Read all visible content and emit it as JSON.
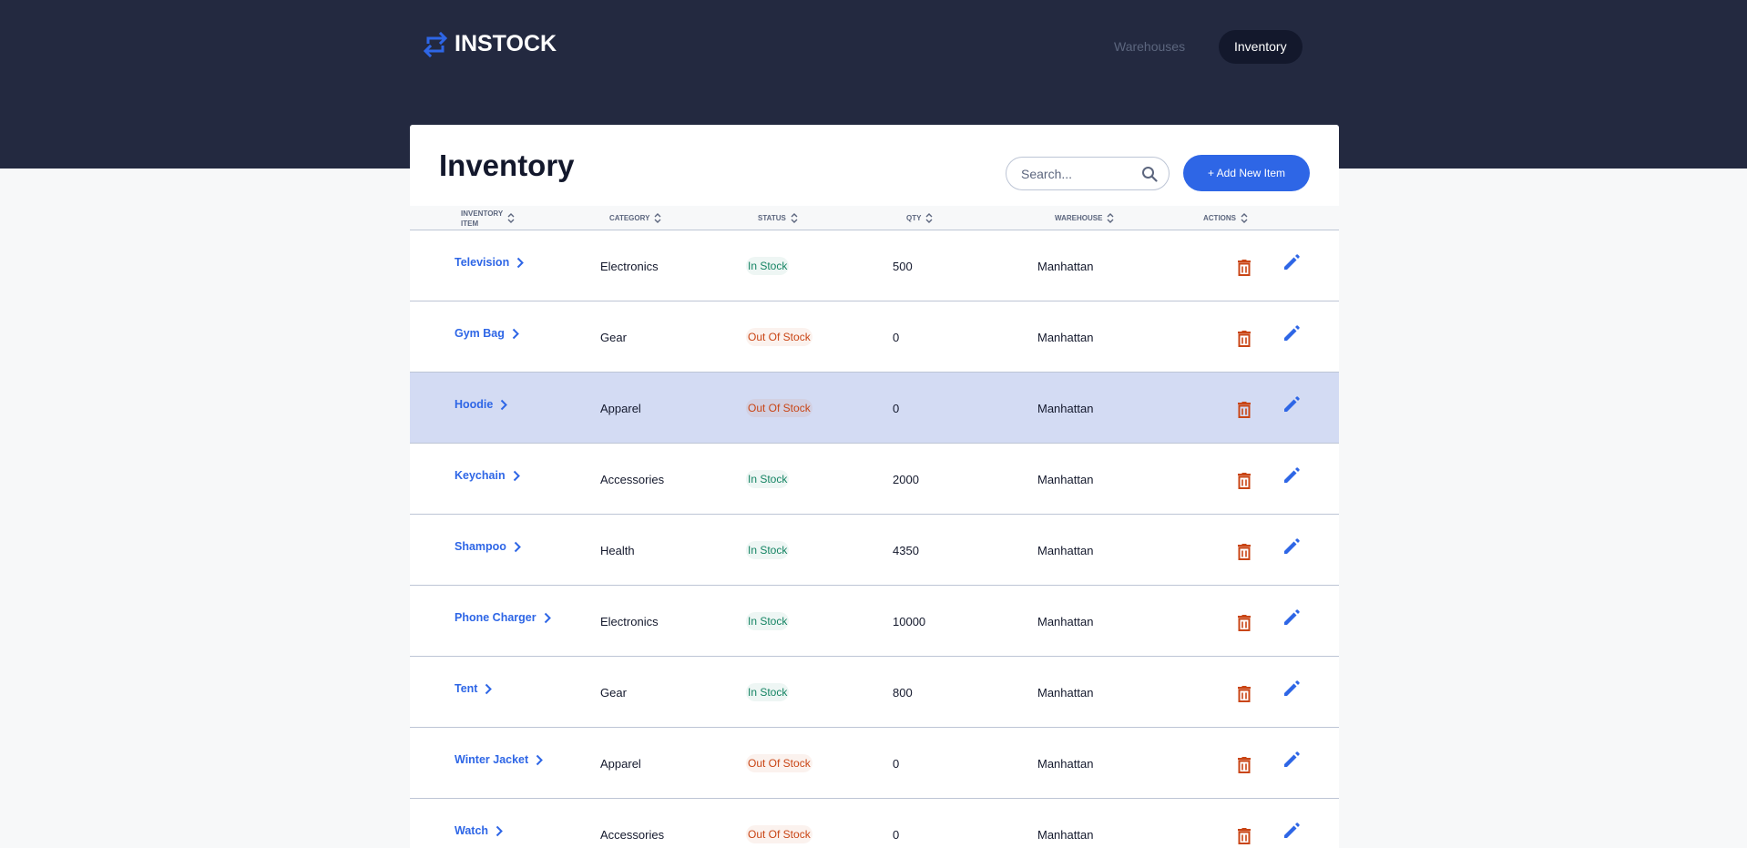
{
  "header": {
    "logo_text": "INSTOCK",
    "nav": [
      {
        "label": "Warehouses",
        "active": false
      },
      {
        "label": "Inventory",
        "active": true
      }
    ]
  },
  "page": {
    "title": "Inventory",
    "search_placeholder": "Search...",
    "add_button": "+ Add New Item"
  },
  "table": {
    "columns": [
      {
        "line1": "Inventory",
        "line2": "Item"
      },
      {
        "label": "Category"
      },
      {
        "label": "Status"
      },
      {
        "label": "Qty"
      },
      {
        "label": "Warehouse"
      },
      {
        "label": "Actions"
      }
    ],
    "rows": [
      {
        "item": "Television",
        "category": "Electronics",
        "status": "In Stock",
        "qty": "500",
        "warehouse": "Manhattan"
      },
      {
        "item": "Gym Bag",
        "category": "Gear",
        "status": "Out Of Stock",
        "qty": "0",
        "warehouse": "Manhattan"
      },
      {
        "item": "Hoodie",
        "category": "Apparel",
        "status": "Out Of Stock",
        "qty": "0",
        "warehouse": "Manhattan",
        "highlighted": true
      },
      {
        "item": "Keychain",
        "category": "Accessories",
        "status": "In Stock",
        "qty": "2000",
        "warehouse": "Manhattan"
      },
      {
        "item": "Shampoo",
        "category": "Health",
        "status": "In Stock",
        "qty": "4350",
        "warehouse": "Manhattan"
      },
      {
        "item": "Phone Charger",
        "category": "Electronics",
        "status": "In Stock",
        "qty": "10000",
        "warehouse": "Manhattan"
      },
      {
        "item": "Tent",
        "category": "Gear",
        "status": "In Stock",
        "qty": "800",
        "warehouse": "Manhattan"
      },
      {
        "item": "Winter Jacket",
        "category": "Apparel",
        "status": "Out Of Stock",
        "qty": "0",
        "warehouse": "Manhattan"
      },
      {
        "item": "Watch",
        "category": "Accessories",
        "status": "Out Of Stock",
        "qty": "0",
        "warehouse": "Manhattan"
      }
    ]
  },
  "colors": {
    "header_bg": "#232940",
    "accent": "#2e66e6",
    "in_stock": "#158463",
    "out_of_stock": "#c94515",
    "highlight_row": "#d3dbf3"
  },
  "icons": {
    "logo": "swap-arrows-icon",
    "search": "search-icon",
    "sort": "sort-icon",
    "row_link": "chevron-right-icon",
    "delete": "delete-icon",
    "edit": "edit-icon"
  }
}
